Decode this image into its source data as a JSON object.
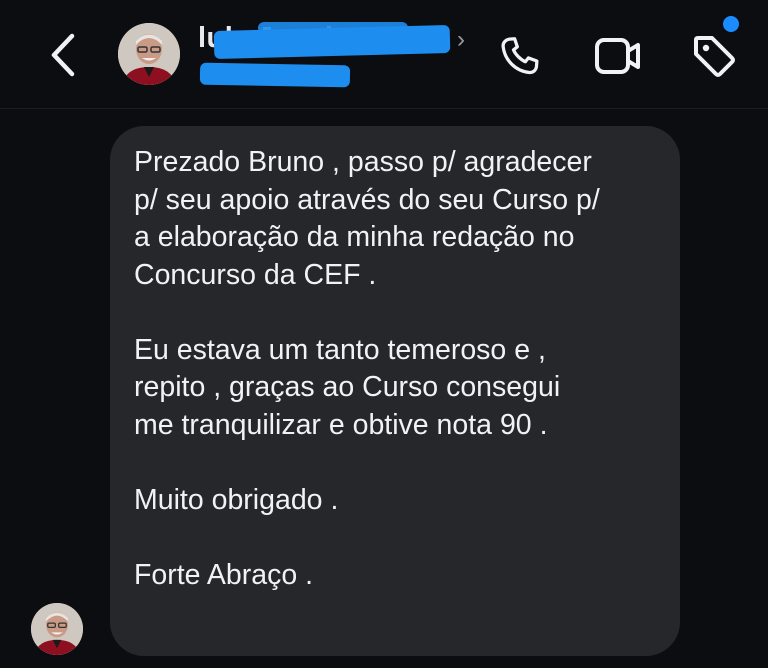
{
  "header": {
    "contact_name": "lulz Juaai...",
    "contact_sub": "",
    "icons": {
      "back": "chevron-left-icon",
      "profile": "chevron-right-icon",
      "call": "phone-icon",
      "video": "video-camera-icon",
      "tag": "tag-icon"
    },
    "notification_dot_color": "#1a8cff"
  },
  "message": {
    "paragraphs": [
      "Prezado Bruno , passo p/ agradecer\np/ seu apoio através do seu Curso p/\na elaboração da minha redação no\nConcurso da CEF .",
      "Eu estava um tanto temeroso e ,\nrepito , graças ao Curso consegui\nme tranquilizar e obtive nota 90 .",
      "Muito obrigado  .",
      "Forte Abraço  ."
    ]
  },
  "colors": {
    "background": "#0c0d10",
    "bubble": "#26272b",
    "text": "#f2f2f4",
    "redaction": "#1e8df0"
  }
}
